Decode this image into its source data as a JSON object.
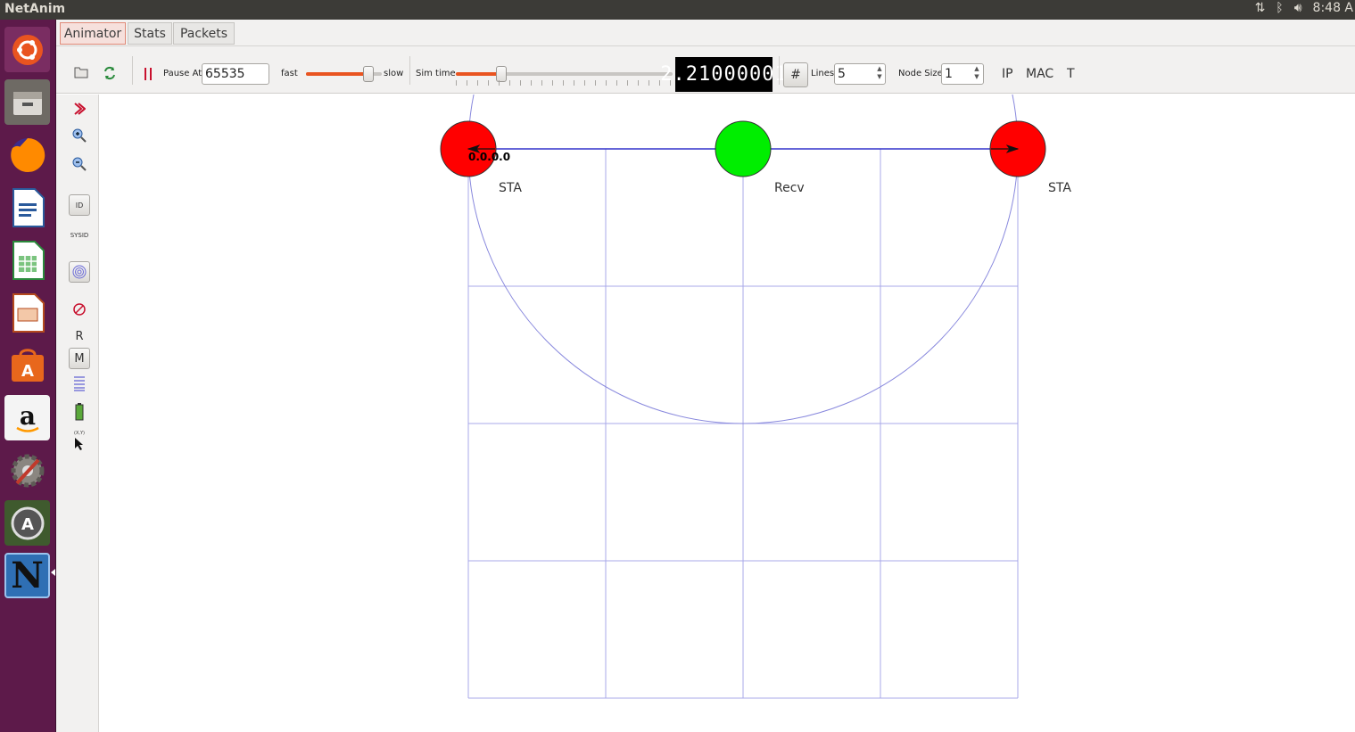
{
  "system_bar": {
    "app_title": "NetAnim",
    "clock": "8:48 A",
    "icons": [
      "network-transfer-icon",
      "bluetooth-icon",
      "volume-icon"
    ]
  },
  "launcher": {
    "items": [
      {
        "name": "ubuntu-home",
        "color": "#d5415a"
      },
      {
        "name": "files",
        "color": "#7c7670"
      },
      {
        "name": "firefox",
        "color": "#e66000"
      },
      {
        "name": "libreoffice-writer",
        "color": "#2a5a9c"
      },
      {
        "name": "libreoffice-calc",
        "color": "#2a8a3c"
      },
      {
        "name": "libreoffice-impress",
        "color": "#b54a1e"
      },
      {
        "name": "ubuntu-software",
        "color": "#e8671c"
      },
      {
        "name": "amazon",
        "color": "#f2f2f2"
      },
      {
        "name": "system-settings",
        "color": "#8a8680"
      },
      {
        "name": "software-updater",
        "color": "#4a4a48"
      },
      {
        "name": "netanim",
        "color": "#2f6fb4",
        "letter": "N"
      }
    ]
  },
  "tabs": [
    {
      "label": "Animator",
      "active": true
    },
    {
      "label": "Stats",
      "active": false
    },
    {
      "label": "Packets",
      "active": false
    }
  ],
  "toolbar": {
    "pause_label": "Pause At",
    "pause_value": "65535",
    "fast_label": "fast",
    "slow_label": "slow",
    "speed_slider_fraction": 0.82,
    "sim_time_label": "Sim time",
    "sim_time_slider_fraction": 0.21,
    "sim_time_display": "2.21000001",
    "grid_icon": "#",
    "lines_label": "Lines",
    "lines_value": "5",
    "node_size_label": "Node Size",
    "node_size_value": "1",
    "ip_label": "IP",
    "mac_label": "MAC",
    "t_label": "T",
    "accent_color": "#e95420"
  },
  "side_tools": {
    "r_label": "R",
    "m_label": "M",
    "id_label": "ID",
    "sysid_label": "SYSID",
    "xy_label": "(X,Y)"
  },
  "canvas": {
    "grid_color": "#a8a8e8",
    "range_color": "#8888dd",
    "link_color": "#3333cc",
    "nodes": [
      {
        "label": "STA",
        "color": "#ff0000",
        "ip": "0.0.0.0"
      },
      {
        "label": "Recv",
        "color": "#00ee00"
      },
      {
        "label": "STA",
        "color": "#ff0000"
      }
    ]
  }
}
